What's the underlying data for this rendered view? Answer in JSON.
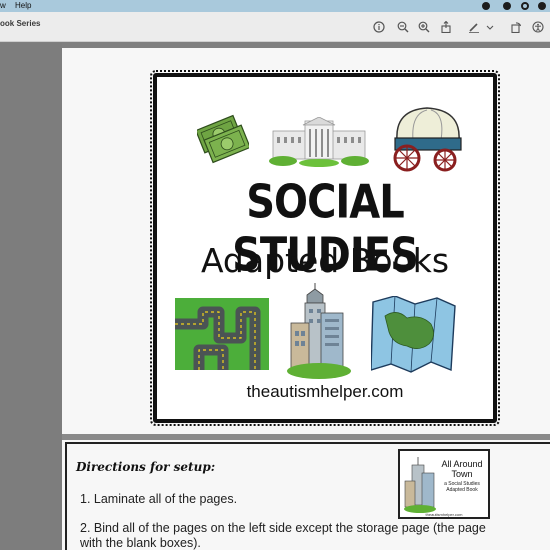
{
  "menubar": {
    "item_partial": "w",
    "help": "Help"
  },
  "toolbar": {
    "title": "ook Series",
    "icons": [
      "info-icon",
      "zoom-out-icon",
      "zoom-in-icon",
      "share-icon",
      "markup-pen-icon",
      "chevron-down-icon",
      "rotate-icon",
      "accessibility-icon"
    ]
  },
  "cover": {
    "title": "SOCIAL STUDIES",
    "subtitle": "Adapted Books",
    "url": "theautismhelper.com"
  },
  "page2": {
    "directions_heading": "Directions for setup:",
    "step1": "1. Laminate all of the pages.",
    "step2": "2. Bind all of the pages on the left side except the storage page (the page with the blank boxes).",
    "thumbnail": {
      "title": "All Around Town",
      "subtitle": "a Social Studies Adapted Book",
      "url": "theautismhelper.com"
    }
  },
  "colors": {
    "menubar": "#a9c9dc",
    "toolbar": "#ececec",
    "background": "#7f7f7f",
    "page": "#f7f7f7"
  }
}
